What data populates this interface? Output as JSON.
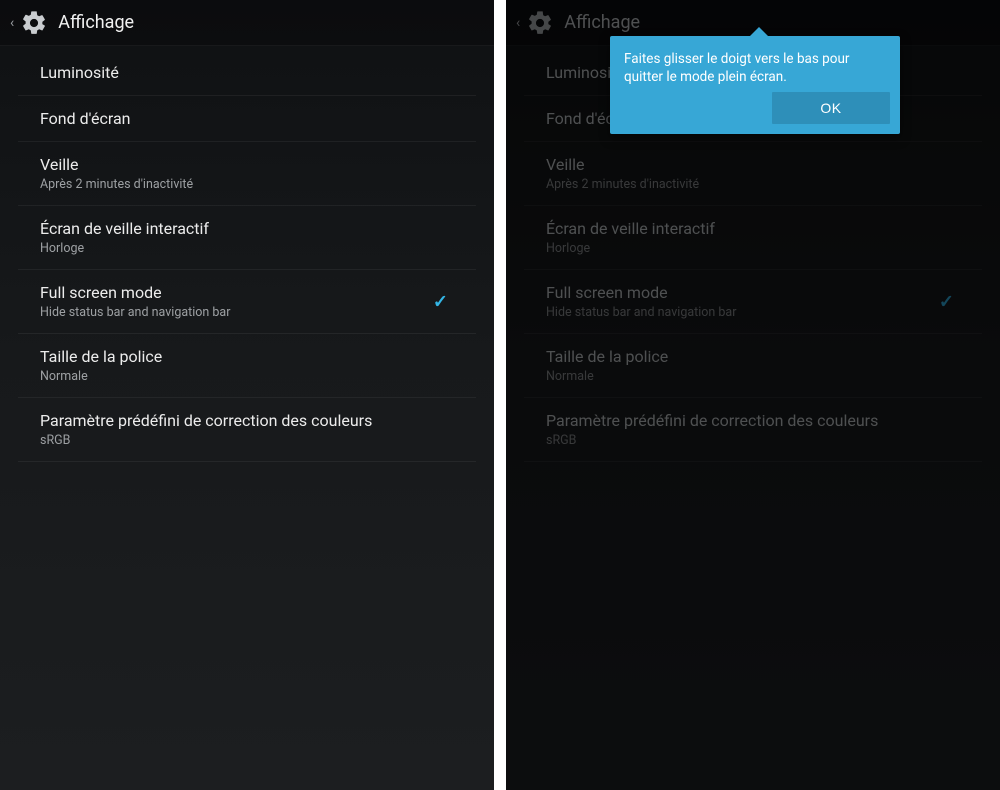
{
  "header": {
    "title": "Affichage"
  },
  "items": [
    {
      "title": "Luminosité",
      "sub": null
    },
    {
      "title": "Fond d'écran",
      "sub": null
    },
    {
      "title": "Veille",
      "sub": "Après 2 minutes d'inactivité"
    },
    {
      "title": "Écran de veille interactif",
      "sub": "Horloge"
    },
    {
      "title": "Full screen mode",
      "sub": "Hide status bar and navigation bar",
      "checked": true
    },
    {
      "title": "Taille de la police",
      "sub": "Normale"
    },
    {
      "title": "Paramètre prédéfini de correction des couleurs",
      "sub": "sRGB"
    }
  ],
  "tooltip": {
    "message": "Faites glisser le doigt vers le bas pour quitter le mode plein écran.",
    "ok": "OK"
  }
}
